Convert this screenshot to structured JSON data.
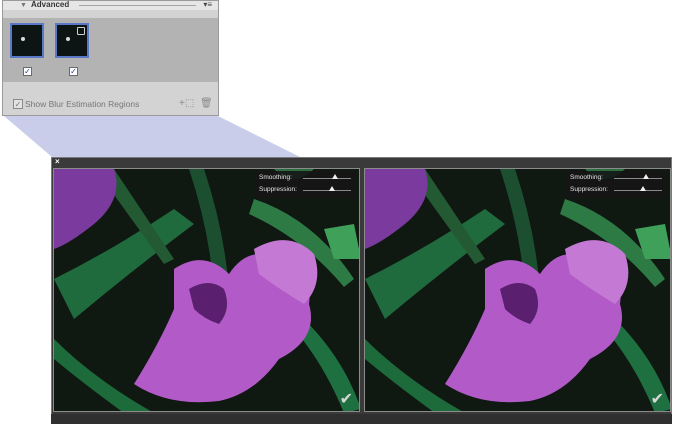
{
  "panel": {
    "title": "Advanced",
    "collapse_glyph": "▼",
    "menu_glyph": "▾≡",
    "thumbnails": [
      {
        "checked": true,
        "check_glyph": "✓",
        "has_lock_icon": false
      },
      {
        "checked": true,
        "check_glyph": "✓",
        "has_lock_icon": true
      }
    ],
    "footer": {
      "show_regions_label": "Show Blur Estimation Regions",
      "show_regions_checked": true,
      "check_glyph": "✓",
      "add_icon_glyph": "+⬚",
      "trash_icon_glyph": "🗑"
    }
  },
  "viewer": {
    "close_glyph": "×",
    "panes": [
      {
        "smoothing_label": "Smoothing:",
        "suppression_label": "Suppression:",
        "smoothing_value": 0.66,
        "suppression_value": 0.6,
        "confirm_glyph": "✔"
      },
      {
        "smoothing_label": "Smoothing:",
        "suppression_label": "Suppression:",
        "smoothing_value": 0.66,
        "suppression_value": 0.6,
        "confirm_glyph": "✔"
      }
    ]
  },
  "colors": {
    "thumb_border": "#5a78c8",
    "wedge": "#c9cde9",
    "flower": "#b25bc8",
    "leaf": "#1f6b3d"
  }
}
